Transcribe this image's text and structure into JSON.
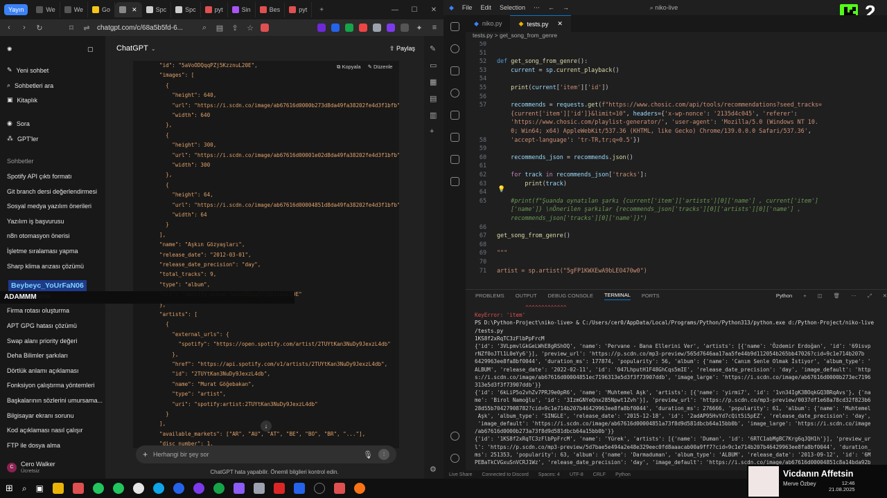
{
  "browser": {
    "stream_label": "Yayın",
    "tabs": [
      {
        "label": "We",
        "color": "#555"
      },
      {
        "label": "We",
        "color": "#555"
      },
      {
        "label": "Go",
        "color": "#f5c518"
      },
      {
        "label": "",
        "color": "#888"
      },
      {
        "label": "Spc",
        "color": "#ccc"
      },
      {
        "label": "Spc",
        "color": "#ccc"
      },
      {
        "label": "pyt",
        "color": "#e05050"
      },
      {
        "label": "Sin",
        "color": "#a855f7"
      },
      {
        "label": "Bes",
        "color": "#e05050"
      },
      {
        "label": "pyt",
        "color": "#e05050"
      }
    ],
    "url": "chatgpt.com/c/68a5b5fd-6..."
  },
  "chatgpt": {
    "sidebar": {
      "new_chat": "Yeni sohbet",
      "search": "Sohbetleri ara",
      "library": "Kitaplık",
      "sora": "Sora",
      "gpts": "GPT'ler",
      "section": "Sohbetler",
      "chats": [
        "Spotify API çıktı formatı",
        "Git branch dersi değerlendirmesi",
        "Sosyal medya yazılım önerileri",
        "Yazılım iş başvurusu",
        "n8n otomasyon önerisi",
        "İşletme sıralaması yapma",
        "Sharp klima arızası çözümü",
        "",
        "...azılımı önerisi",
        "Firma rotası oluşturma",
        "APT GPG hatası çözümü",
        "Swap alanı priority değeri",
        "Deha Bilimler şarkıları",
        "Dörtlük anlamı açıklaması",
        "Fonksiyon çalıştırma yöntemleri",
        "Başkalarının sözlerini umursama...",
        "Bilgisayar ekranı sorunu",
        "Kod açıklaması nasıl çalışır",
        "FTP ile dosya alma"
      ],
      "user_name": "Cero Walker",
      "user_plan": "Ücretsiz"
    },
    "header": {
      "title": "ChatGPT",
      "share": "Paylaş"
    },
    "code_actions": {
      "copy": "Kopyala",
      "edit": "Düzenle"
    },
    "code_lines": [
      {
        "t": "\"id\": \"5aVoODQqqPZj5KzznuL20E\","
      },
      {
        "t": "\"images\": ["
      },
      {
        "t": "  {"
      },
      {
        "t": "    \"height\": 640,"
      },
      {
        "t": "    \"url\": \"https://i.scdn.co/image/ab67616d0000b273d8da49fa38202fe4d3f1bfb\""
      },
      {
        "t": "    \"width\": 640"
      },
      {
        "t": "  },"
      },
      {
        "t": "  {"
      },
      {
        "t": "    \"height\": 300,"
      },
      {
        "t": "    \"url\": \"https://i.scdn.co/image/ab67616d00001e02d8da49fa38202fe4d3f1bfb\""
      },
      {
        "t": "    \"width\": 300"
      },
      {
        "t": "  },"
      },
      {
        "t": "  {"
      },
      {
        "t": "    \"height\": 64,"
      },
      {
        "t": "    \"url\": \"https://i.scdn.co/image/ab67616d00004851d8da49fa38202fe4d3f1bfb\""
      },
      {
        "t": "    \"width\": 64"
      },
      {
        "t": "  }"
      },
      {
        "t": "],"
      },
      {
        "t": "\"name\": \"Aşkın Gözyaşları\","
      },
      {
        "t": "\"release_date\": \"2012-03-01\","
      },
      {
        "t": "\"release_date_precision\": \"day\","
      },
      {
        "t": "\"total_tracks\": 9,"
      },
      {
        "t": "\"type\": \"album\","
      },
      {
        "t": "\"uri\": \"spotify:album:5aVoODQqqPZj5KzznuL20E\""
      },
      {
        "t": "},"
      },
      {
        "t": "\"artists\": ["
      },
      {
        "t": "  {"
      },
      {
        "t": "    \"external_urls\": {"
      },
      {
        "t": "      \"spotify\": \"https://open.spotify.com/artist/2TUYtKan3NuDy9JexzL4db\""
      },
      {
        "t": "    },"
      },
      {
        "t": "    \"href\": \"https://api.spotify.com/v1/artists/2TUYtKan3NuDy9JexzL4db\","
      },
      {
        "t": "    \"id\": \"2TUYtKan3NuDy9JexzL4db\","
      },
      {
        "t": "    \"name\": \"Murat Göğebakan\","
      },
      {
        "t": "    \"type\": \"artist\","
      },
      {
        "t": "    \"uri\": \"spotify:artist:2TUYtKan3NuDy9JexzL4db\""
      },
      {
        "t": "  }"
      },
      {
        "t": "],"
      },
      {
        "t": "\"available_markets\": [\"AR\", \"AU\", \"AT\", \"BE\", \"BO\", \"BR\", \"...\"],"
      },
      {
        "t": "\"disc_number\": 1,"
      }
    ],
    "composer_placeholder": "Herhangi bir şey sor",
    "disclaimer": "ChatGPT hata yapabilir. Önemli bilgileri kontrol edin."
  },
  "overlay": {
    "streamer": "Beybeyc_YoUrFaN06",
    "banner": "ADAMMM",
    "badge": "2"
  },
  "vscode": {
    "menu": [
      "File",
      "Edit",
      "Selection"
    ],
    "search": "niko-live",
    "tabs": [
      {
        "label": "niko.py",
        "active": false
      },
      {
        "label": "tests.py",
        "active": true
      }
    ],
    "breadcrumb": "tests.py  >  get_song_from_genre",
    "code": [
      {
        "n": "50",
        "h": ""
      },
      {
        "n": "51",
        "h": ""
      },
      {
        "n": "52",
        "h": "<span class='kb'>def</span> <span class='fn'>get_song_from_genre</span>():"
      },
      {
        "n": "53",
        "h": "    <span class='vr'>current</span> = <span class='vr'>sp</span>.<span class='fn'>current_playback</span>()"
      },
      {
        "n": "54",
        "h": ""
      },
      {
        "n": "55",
        "h": "    <span class='fn'>print</span>(<span class='vr'>current</span>[<span class='st'>'item'</span>][<span class='st'>'id'</span>])"
      },
      {
        "n": "56",
        "h": ""
      },
      {
        "n": "57",
        "h": "    <span class='vr'>recommends</span> = <span class='vr'>requests</span>.<span class='fn'>get</span>(<span class='st'>f\"https://www.chosic.com/api/tools/recommendations?seed_tracks=</span>"
      },
      {
        "n": "",
        "h": "    <span class='st'>{current['item']['id']}&limit=10\"</span>, <span class='vr'>headers</span>={<span class='st'>'x-wp-nonce'</span>: <span class='st'>'2135d4c045'</span>, <span class='st'>'referer'</span>:"
      },
      {
        "n": "",
        "h": "    <span class='st'>'https://www.chosic.com/playlist-generator/'</span>, <span class='st'>'user-agent'</span>: <span class='st'>'Mozilla/5.0 (Windows NT 10.</span>"
      },
      {
        "n": "",
        "h": "    <span class='st'>0; Win64; x64) AppleWebKit/537.36 (KHTML, like Gecko) Chrome/139.0.0.0 Safari/537.36'</span>,"
      },
      {
        "n": "58",
        "h": "    <span class='st'>'accept-language'</span>: <span class='st'>'tr-TR,tr;q=0.5'</span>})"
      },
      {
        "n": "59",
        "h": ""
      },
      {
        "n": "60",
        "h": "    <span class='vr'>recommends_json</span> = <span class='vr'>recommends</span>.<span class='fn'>json</span>()"
      },
      {
        "n": "61",
        "h": ""
      },
      {
        "n": "62",
        "h": "    <span class='kw'>for</span> <span class='vr'>track</span> <span class='kw'>in</span> <span class='vr'>recommends_json</span>[<span class='st'>'tracks'</span>]:"
      },
      {
        "n": "63",
        "h": "        <span class='fn'>print</span>(<span class='vr'>track</span>)"
      },
      {
        "n": "64",
        "h": ""
      },
      {
        "n": "65",
        "h": "    <span class='cm'>#print(f\"Şuanda oynatılan şarkı {current['item']['artists'][0]['name'] , current['item']</span>"
      },
      {
        "n": "",
        "h": "    <span class='cm'>['name']} \\nÖnerilen şarkılar {recommends_json['tracks'][0]['artists'][0]['name'] ,</span>"
      },
      {
        "n": "",
        "h": "    <span class='cm'>recommends_json['tracks'][0]['name']}\")</span>"
      },
      {
        "n": "66",
        "h": ""
      },
      {
        "n": "67",
        "h": "<span class='fn'>get_song_from_genre</span>()"
      },
      {
        "n": "68",
        "h": ""
      },
      {
        "n": "69",
        "h": "<span class='st'>\"\"\"</span>"
      },
      {
        "n": "70",
        "h": ""
      },
      {
        "n": "71",
        "h": "<span class='st'>artist = sp.artist(\"5gFP1KWXEwA9bLEO470w0\")</span>"
      }
    ],
    "panel_tabs": [
      "PROBLEMS",
      "OUTPUT",
      "DEBUG CONSOLE",
      "TERMINAL",
      "PORTS"
    ],
    "panel_active": "TERMINAL",
    "terminal_shell": "Python",
    "terminal": [
      {
        "t": "                ^^^^^^^^^^^^^",
        "c": "#e05050"
      },
      {
        "t": "KeyError: 'item'",
        "c": "#e05050"
      },
      {
        "t": "PS D:\\Python-Project\\niko-live> & C:/Users/cer0/AppData/Local/Programs/Python/Python313/python.exe d:/Python-Project/niko-live",
        "c": "#ddd"
      },
      {
        "t": "/tests.py",
        "c": "#ddd"
      },
      {
        "t": "1KS8f2xRqTC3zFlbPpFrcM",
        "c": "#ddd"
      },
      {
        "t": "{'id': '3VLpmvlGkGeLWhE8gRShOQ', 'name': 'Pervane - Bana Ellerini Ver', 'artists': [{'name': 'Özdemir Erdoğan', 'id': '69isvp",
        "c": "#ccc"
      },
      {
        "t": "rNZf0oJTl1L0eYy6'}], 'preview_url': 'https://p.scdn.co/mp3-preview/565d7646aa17aa5fe44b9d112054b265bb47026?cid=9c1e714b207b",
        "c": "#ccc"
      },
      {
        "t": "6429963ee8fa8bf0044', 'duration_ms': 177874, 'popularity': 56, 'album': {'name': 'Canım Senle Olmak İstiyor', 'album_type': '",
        "c": "#ccc"
      },
      {
        "t": "ALBUM', 'release_date': '2022-02-11', 'id': '047LhputH1F48GhCqs5mIE', 'release_date_precision': 'day', 'image_default': 'http",
        "c": "#ccc"
      },
      {
        "t": "s://i.scdn.co/image/ab67616d00004851ec7196313e5d3f3f73907ddb', 'image_large': 'https://i.scdn.co/image/ab67616d0000b273ec7196",
        "c": "#ccc"
      },
      {
        "t": "313e5d3f3f73907ddb'}}",
        "c": "#ccc"
      },
      {
        "t": "{'id': '6kLiP5o2vhZv7PRJ9e0pR6', 'name': 'Muhtemel Aşk', 'artists': [{'name': 'yirmi7', 'id': '1vn34IgK3BOqkGQ3BRqAvs'}, {'na",
        "c": "#ccc"
      },
      {
        "t": "me': 'Birol Namoğlu', 'id': '3IzmGNYeQnx285Npwt1Zvh'}], 'preview_url': 'https://p.scdn.co/mp3-preview/0037df1e68a78cd32f823b6",
        "c": "#ccc"
      },
      {
        "t": "28d55b70427908782?cid=9c1e714b207b46429963ee8fa8bf0044', 'duration_ms': 276666, 'popularity': 61, 'album': {'name': 'Muhtemel",
        "c": "#ccc"
      },
      {
        "t": " Aşk', 'album_type': 'SINGLE', 'release_date': '2015-12-18', 'id': '2adAP95HvYd7cQit5i5pEZ', 'release_date_precision': 'day',",
        "c": "#ccc"
      },
      {
        "t": " 'image_default': 'https://i.scdn.co/image/ab67616d00004851a73f8d9d581dbcb64a15bb0b', 'image_large': 'https://i.scdn.co/image",
        "c": "#ccc"
      },
      {
        "t": "/ab67616d0000b273a73f8d9d581dbcb64a15bb0b'}}",
        "c": "#ccc"
      },
      {
        "t": "{'id': '1KS8f2xRqTC3zFlbPpFrcM', 'name': 'Yürek', 'artists': [{'name': 'Duman', 'id': '6RTC1abMgBC7Krg6qJQH1h'}], 'preview_ur",
        "c": "#ccc"
      },
      {
        "t": "l': 'https://p.scdn.co/mp3-preview/5d7bae5e494a2e48e329eec0fd8aaacab00a9ff7?cid=9c1e714b207b46429963ee8fa8bf0044', 'duration_",
        "c": "#ccc"
      },
      {
        "t": "ms': 251353, 'popularity': 63, 'album': {'name': 'Darmaduman', 'album_type': 'ALBUM', 'release_date': '2013-09-12', 'id': '6M",
        "c": "#ccc"
      },
      {
        "t": "PEBaTkCVGxuSnVCRJ1Wz', 'release_date_precision': 'day', 'image_default': 'https://i.scdn.co/image/ab67616d00004851c8a14bda92b",
        "c": "#ccc"
      }
    ],
    "status": [
      "Live Share",
      "Connected to Discord",
      "Spaces: 4",
      "UTF-8",
      "CRLF",
      "Python"
    ]
  },
  "media": {
    "title": "Vicdanın Affetsin",
    "artist": "Merve Özbey"
  },
  "clock": {
    "time": "12:46",
    "date": "21.08.2025"
  }
}
